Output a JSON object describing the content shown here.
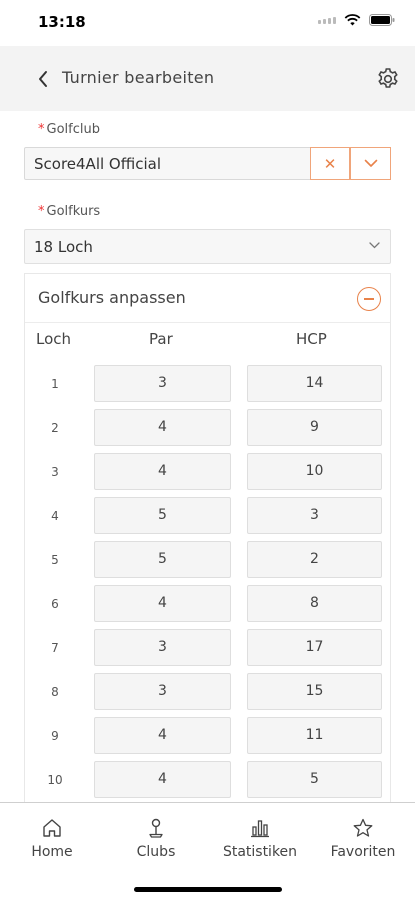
{
  "status_bar": {
    "time": "13:18"
  },
  "header": {
    "title": "Turnier bearbeiten",
    "back_icon": "chevron-left-icon",
    "settings_icon": "gear-icon"
  },
  "form": {
    "golfclub": {
      "label": "Golfclub",
      "required_mark": "*",
      "value": "Score4All Official",
      "clear_symbol": "✕"
    },
    "golfkurs": {
      "label": "Golfkurs",
      "required_mark": "*",
      "value": "18 Loch"
    }
  },
  "course_panel": {
    "title": "Golfkurs anpassen",
    "columns": {
      "hole": "Loch",
      "par": "Par",
      "hcp": "HCP"
    },
    "holes": [
      {
        "hole": "1",
        "par": "3",
        "hcp": "14"
      },
      {
        "hole": "2",
        "par": "4",
        "hcp": "9"
      },
      {
        "hole": "3",
        "par": "4",
        "hcp": "10"
      },
      {
        "hole": "4",
        "par": "5",
        "hcp": "3"
      },
      {
        "hole": "5",
        "par": "5",
        "hcp": "2"
      },
      {
        "hole": "6",
        "par": "4",
        "hcp": "8"
      },
      {
        "hole": "7",
        "par": "3",
        "hcp": "17"
      },
      {
        "hole": "8",
        "par": "3",
        "hcp": "15"
      },
      {
        "hole": "9",
        "par": "4",
        "hcp": "11"
      },
      {
        "hole": "10",
        "par": "4",
        "hcp": "5"
      }
    ]
  },
  "tab_bar": {
    "items": [
      {
        "label": "Home",
        "icon": "home-icon"
      },
      {
        "label": "Clubs",
        "icon": "golf-tee-icon"
      },
      {
        "label": "Statistiken",
        "icon": "bar-chart-icon"
      },
      {
        "label": "Favoriten",
        "icon": "star-icon"
      }
    ]
  },
  "colors": {
    "accent": "#e8824a",
    "required": "#ee3333",
    "header_bg": "#f3f3f3"
  }
}
